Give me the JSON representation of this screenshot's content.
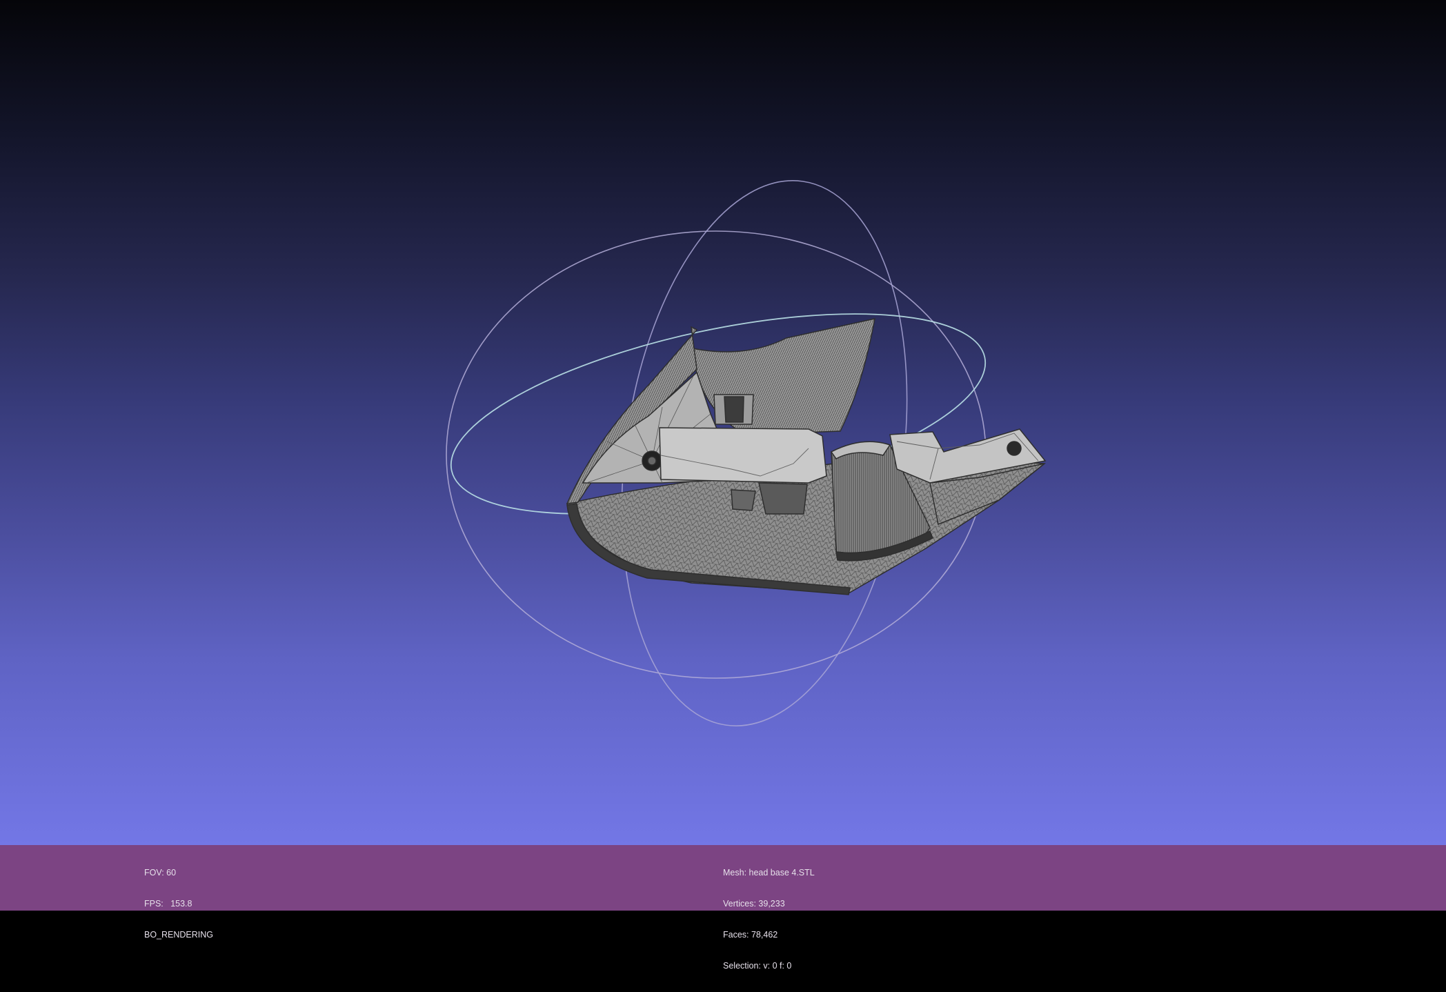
{
  "app": "MeshLab 3D viewer",
  "info_left": {
    "fov": "FOV: 60",
    "fps": "FPS:   153.8",
    "mode": "BO_RENDERING"
  },
  "info_right": {
    "mesh": "Mesh: head base 4.STL",
    "vertices": "Vertices: 39,233",
    "faces": "Faces: 78,462",
    "selection": "Selection: v: 0 f: 0"
  },
  "colors": {
    "background_top": "#050509",
    "background_bottom": "#7377e6",
    "info_bar": "#7c4483",
    "mesh_fill": "#8c8c8c",
    "mesh_light": "#c8c8c8",
    "mesh_dark": "#3c3c3c",
    "trackball": "#b9b3dc"
  },
  "icons": {
    "trackball": "trackball-gizmo",
    "model": "wireframe-mesh-model"
  }
}
